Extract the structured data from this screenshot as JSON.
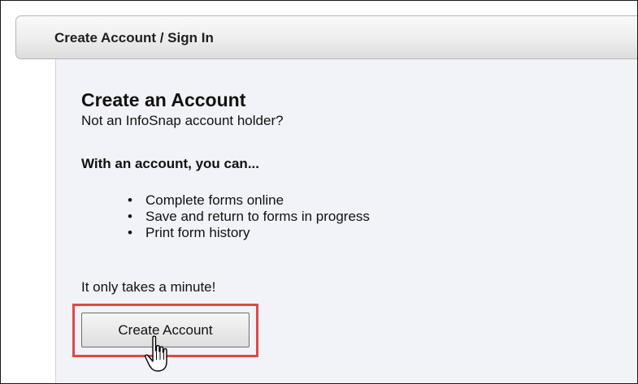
{
  "header": {
    "title": "Create Account / Sign In"
  },
  "create_account": {
    "heading": "Create an Account",
    "subtitle": "Not an InfoSnap account holder?",
    "benefits_heading": "With an account, you can...",
    "benefits": [
      "Complete forms online",
      "Save and return to forms in progress",
      "Print form history"
    ],
    "note": "It only takes a minute!",
    "button_label": "Create Account"
  },
  "colors": {
    "highlight": "#e04848",
    "panel_background": "#f1f3f8",
    "header_gradient_top": "#fafafa",
    "header_gradient_bottom": "#dcdcdc"
  },
  "cursor": {
    "icon": "hand-pointer-icon"
  }
}
